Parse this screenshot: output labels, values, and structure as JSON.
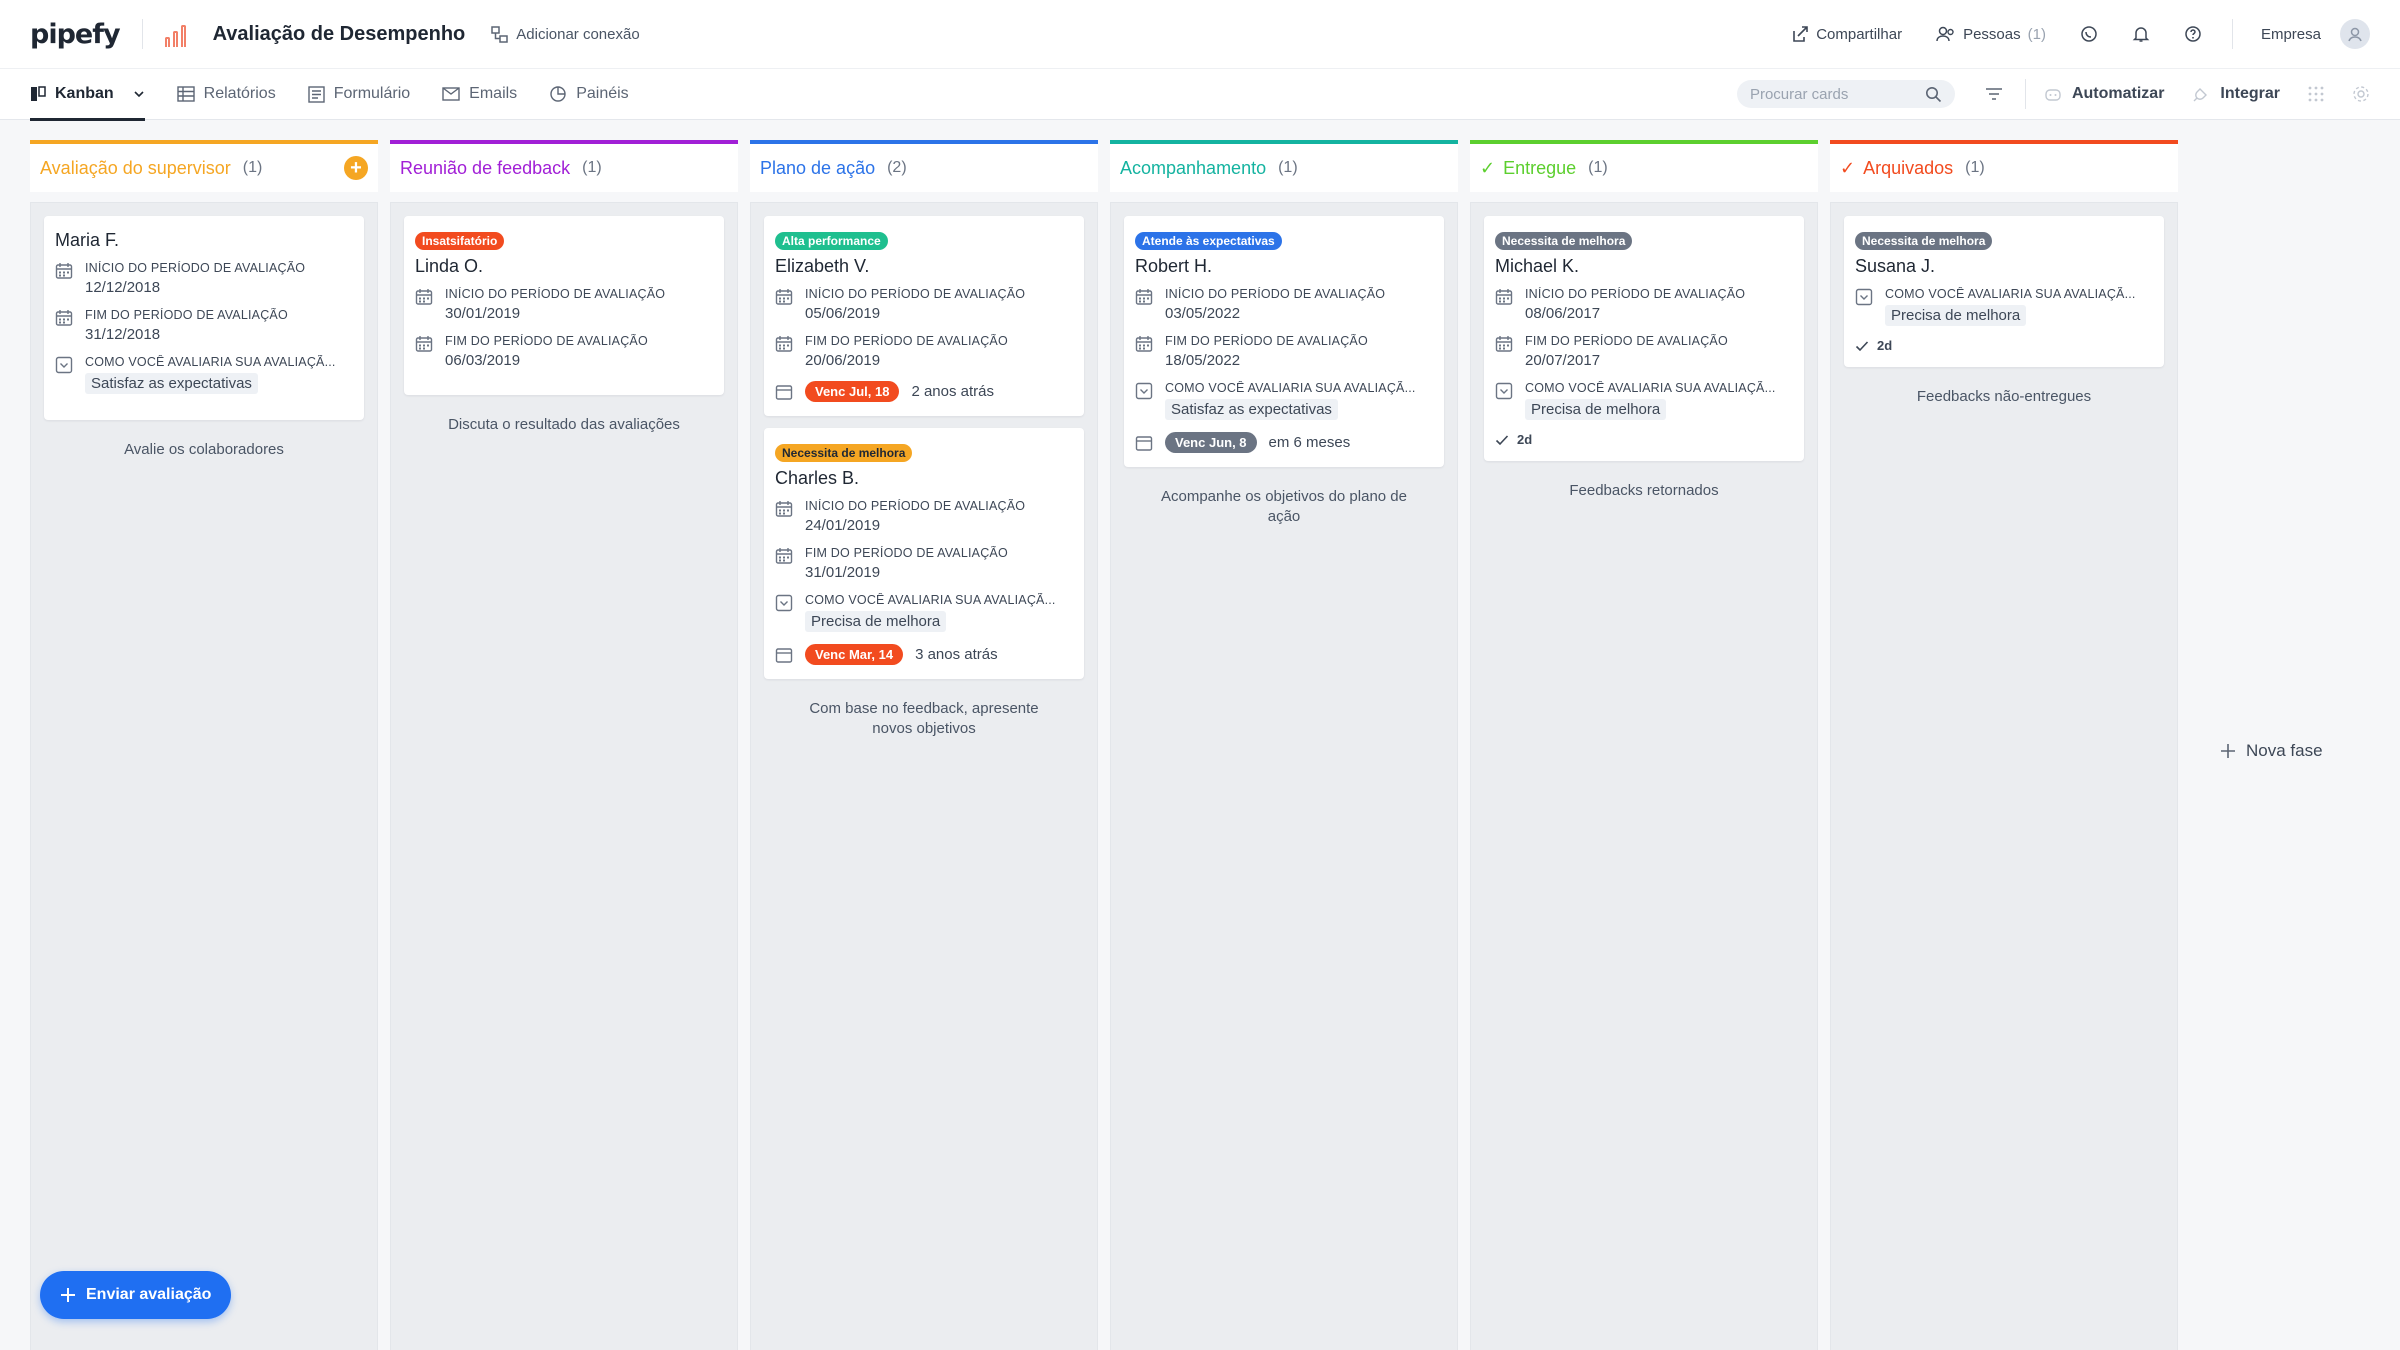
{
  "header": {
    "logo": "pipefy",
    "pipe_title": "Avaliação de Desempenho",
    "add_connection": "Adicionar conexão",
    "share": "Compartilhar",
    "people": "Pessoas",
    "people_count": "(1)",
    "company": "Empresa"
  },
  "nav": {
    "tabs": [
      {
        "label": "Kanban",
        "icon": "kanban-icon",
        "active": true
      },
      {
        "label": "Relatórios",
        "icon": "table-icon"
      },
      {
        "label": "Formulário",
        "icon": "form-icon"
      },
      {
        "label": "Emails",
        "icon": "mail-icon"
      },
      {
        "label": "Painéis",
        "icon": "dashboard-icon"
      }
    ],
    "search_placeholder": "Procurar cards",
    "automate": "Automatizar",
    "integrate": "Integrar"
  },
  "phases": [
    {
      "name": "Avaliação do supervisor",
      "count": "(1)",
      "color": "#f5a623",
      "check": false,
      "add": true,
      "description": "Avalie os colaboradores",
      "cards": [
        {
          "title": "Maria F.",
          "badge": null,
          "fields": [
            {
              "icon": "calendar-icon",
              "label": "INÍCIO DO PERÍODO DE AVALIAÇÃO",
              "value": "12/12/2018"
            },
            {
              "icon": "calendar-icon",
              "label": "FIM DO PERÍODO DE AVALIAÇÃO",
              "value": "31/12/2018"
            },
            {
              "icon": "select-icon",
              "label": "COMO VOCÊ AVALIARIA SUA AVALIAÇÃ...",
              "chip": "Satisfaz as expectativas"
            }
          ]
        }
      ]
    },
    {
      "name": "Reunião de feedback",
      "count": "(1)",
      "color": "#a11fd6",
      "check": false,
      "description": "Discuta o resultado das avaliações",
      "cards": [
        {
          "title": "Linda O.",
          "badge": {
            "text": "Insatsifatório",
            "color": "#f24b1f"
          },
          "fields": [
            {
              "icon": "calendar-icon",
              "label": "INÍCIO DO PERÍODO DE AVALIAÇÃO",
              "value": "30/01/2019"
            },
            {
              "icon": "calendar-icon",
              "label": "FIM DO PERÍODO DE AVALIAÇÃO",
              "value": "06/03/2019"
            }
          ]
        }
      ]
    },
    {
      "name": "Plano de ação",
      "count": "(2)",
      "color": "#2c73e8",
      "check": false,
      "description": "Com base no feedback, apresente novos objetivos",
      "cards": [
        {
          "title": "Elizabeth V.",
          "badge": {
            "text": "Alta performance",
            "color": "#1fbf8f"
          },
          "fields": [
            {
              "icon": "calendar-icon",
              "label": "INÍCIO DO PERÍODO DE AVALIAÇÃO",
              "value": "05/06/2019"
            },
            {
              "icon": "calendar-icon",
              "label": "FIM DO PERÍODO DE AVALIAÇÃO",
              "value": "20/06/2019"
            }
          ],
          "due": {
            "pill": "Venc Jul, 18",
            "color": "#f24b1f",
            "text": "2 anos atrás"
          }
        },
        {
          "title": "Charles B.",
          "badge": {
            "text": "Necessita de melhora",
            "color": "#f5a623",
            "dark": true
          },
          "fields": [
            {
              "icon": "calendar-icon",
              "label": "INÍCIO DO PERÍODO DE AVALIAÇÃO",
              "value": "24/01/2019"
            },
            {
              "icon": "calendar-icon",
              "label": "FIM DO PERÍODO DE AVALIAÇÃO",
              "value": "31/01/2019"
            },
            {
              "icon": "select-icon",
              "label": "COMO VOCÊ AVALIARIA SUA AVALIAÇÃ...",
              "chip": "Precisa de melhora"
            }
          ],
          "due": {
            "pill": "Venc Mar, 14",
            "color": "#f24b1f",
            "text": "3 anos atrás"
          }
        }
      ]
    },
    {
      "name": "Acompanhamento",
      "count": "(1)",
      "color": "#14b3a0",
      "check": false,
      "description": "Acompanhe os objetivos do plano de ação",
      "cards": [
        {
          "title": "Robert H.",
          "badge": {
            "text": "Atende às expectativas",
            "color": "#2c73e8"
          },
          "fields": [
            {
              "icon": "calendar-icon",
              "label": "INÍCIO DO PERÍODO DE AVALIAÇÃO",
              "value": "03/05/2022"
            },
            {
              "icon": "calendar-icon",
              "label": "FIM DO PERÍODO DE AVALIAÇÃO",
              "value": "18/05/2022"
            },
            {
              "icon": "select-icon",
              "label": "COMO VOCÊ AVALIARIA SUA AVALIAÇÃ...",
              "chip": "Satisfaz as expectativas"
            }
          ],
          "due": {
            "pill": "Venc Jun, 8",
            "color": "#6b7483",
            "text": "em 6 meses"
          }
        }
      ]
    },
    {
      "name": "Entregue",
      "count": "(1)",
      "color": "#5ccf2e",
      "check": true,
      "description": "Feedbacks retornados",
      "cards": [
        {
          "title": "Michael K.",
          "badge": {
            "text": "Necessita de melhora",
            "color": "#6b7483"
          },
          "fields": [
            {
              "icon": "calendar-icon",
              "label": "INÍCIO DO PERÍODO DE AVALIAÇÃO",
              "value": "08/06/2017"
            },
            {
              "icon": "calendar-icon",
              "label": "FIM DO PERÍODO DE AVALIAÇÃO",
              "value": "20/07/2017"
            },
            {
              "icon": "select-icon",
              "label": "COMO VOCÊ AVALIARIA SUA AVALIAÇÃ...",
              "chip": "Precisa de melhora"
            }
          ],
          "done": "2d"
        }
      ]
    },
    {
      "name": "Arquivados",
      "count": "(1)",
      "color": "#f24b1f",
      "check": true,
      "description": "Feedbacks não-entregues",
      "cards": [
        {
          "title": "Susana J.",
          "badge": {
            "text": "Necessita de melhora",
            "color": "#6b7483"
          },
          "fields": [
            {
              "icon": "select-icon",
              "label": "COMO VOCÊ AVALIARIA SUA AVALIAÇÃ...",
              "chip": "Precisa de melhora"
            }
          ],
          "done": "2d"
        }
      ]
    }
  ],
  "new_phase": "Nova fase",
  "fab_label": "Enviar avaliação"
}
